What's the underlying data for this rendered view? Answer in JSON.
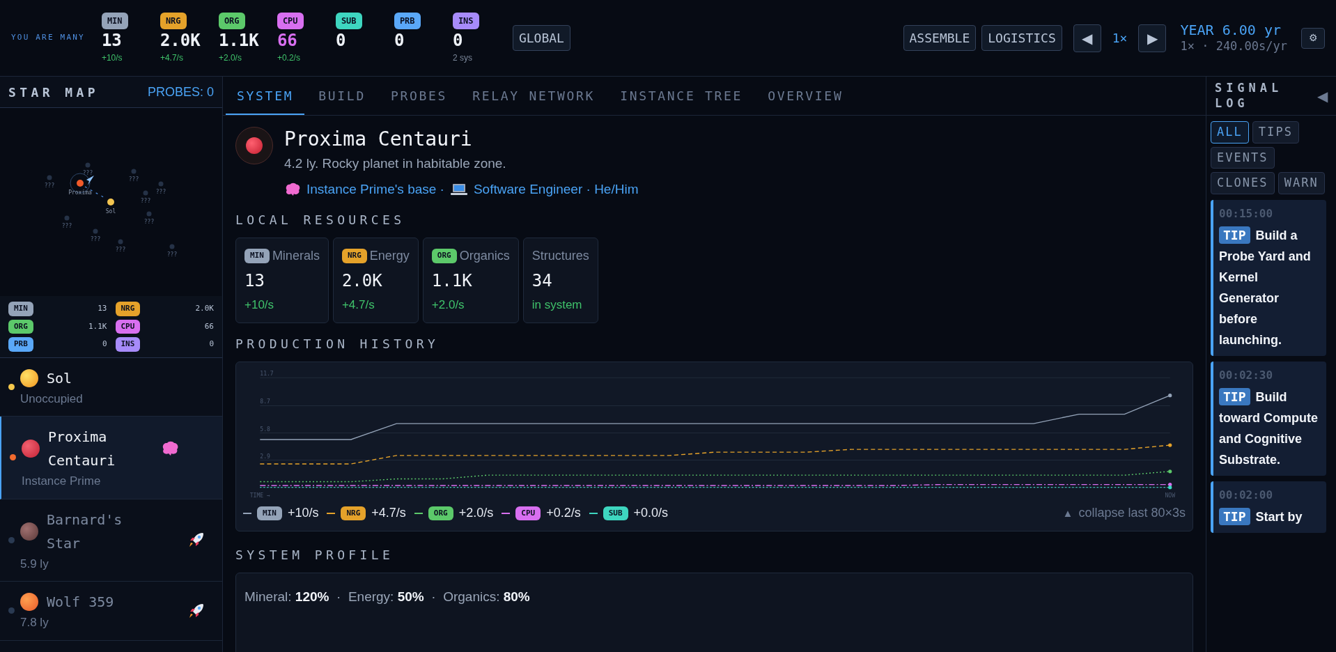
{
  "header": {
    "tagline": "YOU ARE MANY",
    "resources": [
      {
        "code": "MIN",
        "color": "#94a3b8",
        "value": "13",
        "rate": "+10/s",
        "highlight": false
      },
      {
        "code": "NRG",
        "color": "#e5a22a",
        "value": "2.0K",
        "rate": "+4.7/s",
        "highlight": false
      },
      {
        "code": "ORG",
        "color": "#5cc96a",
        "value": "1.1K",
        "rate": "+2.0/s",
        "highlight": false
      },
      {
        "code": "CPU",
        "color": "#d86ff0",
        "value": "66",
        "rate": "+0.2/s",
        "highlight": true
      },
      {
        "code": "SUB",
        "color": "#3ed6c0",
        "value": "0",
        "highlight": false
      },
      {
        "code": "PRB",
        "color": "#5aa8f8",
        "value": "0",
        "highlight": false
      },
      {
        "code": "INS",
        "color": "#a78bfa",
        "value": "0",
        "note": "2 sys",
        "highlight": false
      }
    ],
    "global_button": "GLOBAL",
    "actions": [
      "ASSEMBLE",
      "LOGISTICS"
    ],
    "speed": {
      "prev": "◀",
      "value": "1×",
      "next": "▶"
    },
    "year": "YEAR 6.00 yr",
    "rate": "1× · 240.00s/yr",
    "settings": "⚙"
  },
  "star_map": {
    "title": "STAR MAP",
    "probes": "PROBES: 0",
    "nodes": [
      {
        "label": "Proxima",
        "kind": "home"
      },
      {
        "label": "Sol",
        "kind": "sun"
      },
      {
        "label": "???",
        "kind": "unknown"
      },
      {
        "label": "???",
        "kind": "unknown"
      },
      {
        "label": "???",
        "kind": "unknown"
      },
      {
        "label": "???",
        "kind": "unknown"
      },
      {
        "label": "???",
        "kind": "unknown"
      },
      {
        "label": "???",
        "kind": "unknown"
      },
      {
        "label": "???",
        "kind": "unknown"
      },
      {
        "label": "???",
        "kind": "unknown"
      },
      {
        "label": "???",
        "kind": "unknown"
      },
      {
        "label": "???",
        "kind": "unknown"
      }
    ],
    "resources": [
      {
        "code": "MIN",
        "color": "#94a3b8",
        "value": "13"
      },
      {
        "code": "NRG",
        "color": "#e5a22a",
        "value": "2.0K"
      },
      {
        "code": "ORG",
        "color": "#5cc96a",
        "value": "1.1K"
      },
      {
        "code": "CPU",
        "color": "#d86ff0",
        "value": "66"
      },
      {
        "code": "PRB",
        "color": "#5aa8f8",
        "value": "0"
      },
      {
        "code": "INS",
        "color": "#a78bfa",
        "value": "0"
      }
    ]
  },
  "systems": [
    {
      "name": "Sol",
      "subtitle": "Unoccupied",
      "kind": "sun",
      "color": "#f5c84c",
      "selected": false,
      "visited": true,
      "instance": false,
      "probe": false
    },
    {
      "name": "Proxima Centauri",
      "subtitle": "Instance Prime",
      "kind": "red",
      "color": "#f26a2e",
      "selected": true,
      "visited": true,
      "instance": true,
      "probe": false
    },
    {
      "name": "Barnard's Star",
      "subtitle": "5.9 ly",
      "kind": "brown",
      "color": "#2a3a52",
      "selected": false,
      "visited": false,
      "instance": false,
      "probe": true
    },
    {
      "name": "Wolf 359",
      "subtitle": "7.8 ly",
      "kind": "orange",
      "color": "#2a3a52",
      "selected": false,
      "visited": false,
      "instance": false,
      "probe": true
    }
  ],
  "tabs": [
    {
      "label": "SYSTEM",
      "selected": true
    },
    {
      "label": "BUILD",
      "selected": false
    },
    {
      "label": "PROBES",
      "selected": false
    },
    {
      "label": "RELAY NETWORK",
      "selected": false
    },
    {
      "label": "INSTANCE TREE",
      "selected": false
    },
    {
      "label": "OVERVIEW",
      "selected": false
    }
  ],
  "system": {
    "name": "Proxima Centauri",
    "description": "4.2 ly. Rocky planet in habitable zone.",
    "base": "Instance Prime's base ·",
    "role": "Software Engineer · He/Him"
  },
  "local_resources": {
    "title": "LOCAL RESOURCES",
    "cards": [
      {
        "code": "MIN",
        "color": "#94a3b8",
        "label": "Minerals",
        "value": "13",
        "rate": "+10/s"
      },
      {
        "code": "NRG",
        "color": "#e5a22a",
        "label": "Energy",
        "value": "2.0K",
        "rate": "+4.7/s"
      },
      {
        "code": "ORG",
        "color": "#5cc96a",
        "label": "Organics",
        "value": "1.1K",
        "rate": "+2.0/s"
      },
      {
        "label": "Structures",
        "value": "34",
        "rate": "in system"
      }
    ]
  },
  "production_history": {
    "title": "PRODUCTION HISTORY",
    "chart_data": {
      "type": "line",
      "categories": [
        "TIME →",
        null,
        null,
        null,
        null,
        null,
        null,
        null,
        null,
        null,
        null,
        null,
        null,
        null,
        null,
        null,
        null,
        null,
        null,
        null,
        "NOW"
      ],
      "ylim": [
        0,
        11.7
      ],
      "grid": true,
      "yticks": [
        2.9,
        5.8,
        8.7,
        11.7
      ],
      "series": [
        {
          "name": "MIN",
          "color": "#94a3b8",
          "line_style": "solid",
          "values": [
            5.1,
            5.1,
            5.1,
            6.8,
            6.8,
            6.8,
            6.8,
            6.8,
            6.8,
            6.8,
            6.8,
            6.8,
            6.8,
            6.8,
            6.8,
            6.8,
            6.8,
            6.8,
            7.8,
            7.8,
            9.8
          ]
        },
        {
          "name": "NRG",
          "color": "#e5a22a",
          "line_style": "dashed",
          "values": [
            2.5,
            2.5,
            2.5,
            3.4,
            3.4,
            3.4,
            3.4,
            3.4,
            3.4,
            3.4,
            3.75,
            3.75,
            3.75,
            4.05,
            4.05,
            4.05,
            4.05,
            4.05,
            4.05,
            4.05,
            4.5
          ]
        },
        {
          "name": "ORG",
          "color": "#5cc96a",
          "line_style": "dotted",
          "values": [
            0.6,
            0.6,
            0.6,
            0.9,
            0.9,
            1.3,
            1.3,
            1.3,
            1.3,
            1.3,
            1.3,
            1.3,
            1.3,
            1.3,
            1.3,
            1.3,
            1.3,
            1.3,
            1.3,
            1.3,
            1.7
          ]
        },
        {
          "name": "CPU",
          "color": "#d86ff0",
          "line_style": "dashdot",
          "values": [
            0.2,
            0.2,
            0.2,
            0.2,
            0.2,
            0.2,
            0.2,
            0.2,
            0.2,
            0.2,
            0.2,
            0.2,
            0.2,
            0.2,
            0.2,
            0.3,
            0.3,
            0.3,
            0.3,
            0.3,
            0.3
          ]
        },
        {
          "name": "SUB",
          "color": "#3ed6c0",
          "line_style": "dotted",
          "values": [
            0,
            0,
            0,
            0,
            0,
            0,
            0,
            0,
            0,
            0,
            0,
            0,
            0,
            0,
            0,
            0,
            0,
            0,
            0,
            0,
            0
          ]
        }
      ]
    },
    "legend_rates": [
      "+10/s",
      "+4.7/s",
      "+2.0/s",
      "+0.2/s",
      "+0.0/s"
    ],
    "collapse": {
      "icon": "▲",
      "label": "collapse last 80×3s"
    }
  },
  "system_profile": {
    "title": "SYSTEM PROFILE",
    "text": "Mineral: **120%**  ·  Energy: **50%**  ·  Organics: **80%**"
  },
  "signal_log": {
    "title": "SIGNAL LOG",
    "collapse": "◀",
    "filters": [
      {
        "label": "ALL",
        "selected": true
      },
      {
        "label": "TIPS",
        "selected": false
      },
      {
        "label": "EVENTS",
        "selected": false
      },
      {
        "label": "CLONES",
        "selected": false
      },
      {
        "label": "WARN",
        "selected": false
      }
    ],
    "entries": [
      {
        "time": "00:15:00",
        "tag": "TIP",
        "text": "Build a Probe Yard and Kernel Generator before launching."
      },
      {
        "time": "00:02:30",
        "tag": "TIP",
        "text": "Build toward Compute and Cognitive Substrate."
      },
      {
        "time": "00:02:00",
        "tag": "TIP",
        "text": "Start by"
      }
    ]
  }
}
